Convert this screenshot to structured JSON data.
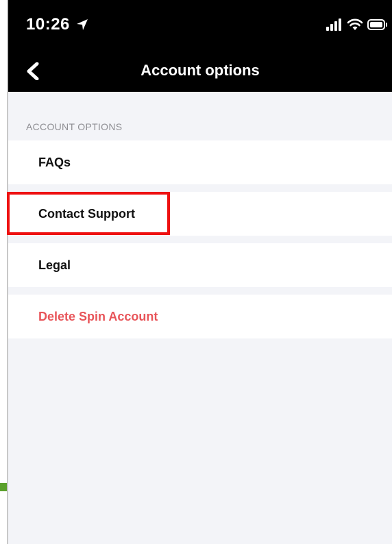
{
  "status_bar": {
    "time": "10:26",
    "icons": [
      "location-arrow-icon",
      "signal-icon",
      "wifi-icon",
      "battery-icon"
    ]
  },
  "nav": {
    "back_icon": "chevron-left-icon",
    "title": "Account options"
  },
  "section": {
    "header": "ACCOUNT OPTIONS",
    "items": [
      {
        "label": "FAQs"
      },
      {
        "label": "Contact Support"
      },
      {
        "label": "Legal"
      },
      {
        "label": "Delete Spin Account"
      }
    ]
  },
  "colors": {
    "nav_background": "#000000",
    "page_background": "#f3f4f8",
    "destructive": "#e8555a",
    "highlight": "#ee1111"
  }
}
